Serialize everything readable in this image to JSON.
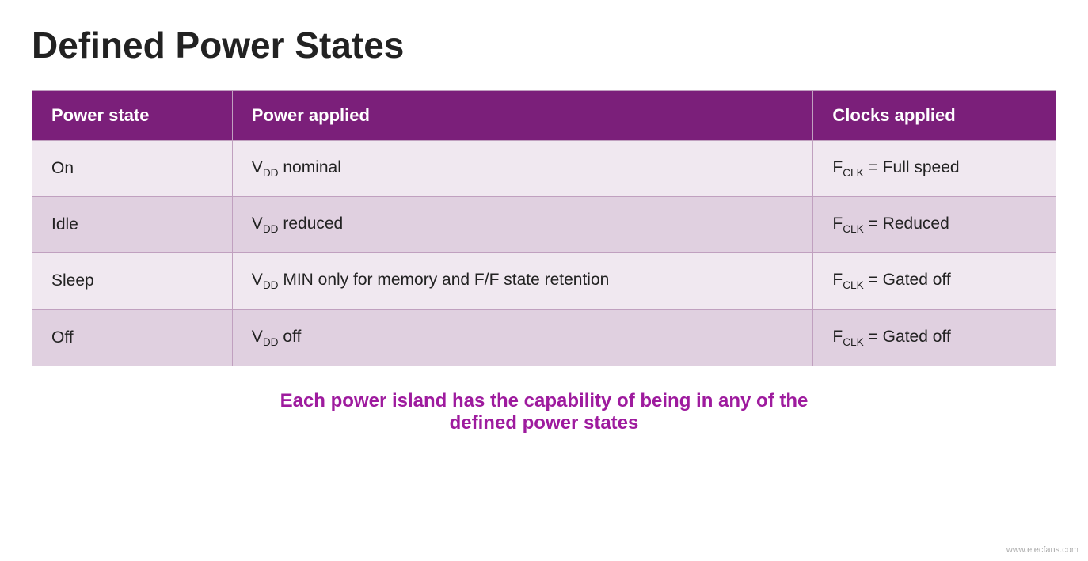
{
  "title": "Defined Power States",
  "table": {
    "headers": [
      "Power state",
      "Power applied",
      "Clocks applied"
    ],
    "rows": [
      {
        "state": "On",
        "power_applied_html": "V<sub>DD</sub> nominal",
        "clocks_applied_html": "F<sub>CLK</sub> = Full speed"
      },
      {
        "state": "Idle",
        "power_applied_html": "V<sub>DD</sub> reduced",
        "clocks_applied_html": "F<sub>CLK</sub> = Reduced"
      },
      {
        "state": "Sleep",
        "power_applied_html": "V<sub>DD</sub> MIN only for memory and F/F state retention",
        "clocks_applied_html": "F<sub>CLK</sub> = Gated off"
      },
      {
        "state": "Off",
        "power_applied_html": "V<sub>DD</sub> off",
        "clocks_applied_html": "F<sub>CLK</sub> = Gated off"
      }
    ]
  },
  "footer": {
    "line1": "Each power island has the capability of being in any of the",
    "line2": "defined power states"
  },
  "watermark": "www.elecfans.com"
}
